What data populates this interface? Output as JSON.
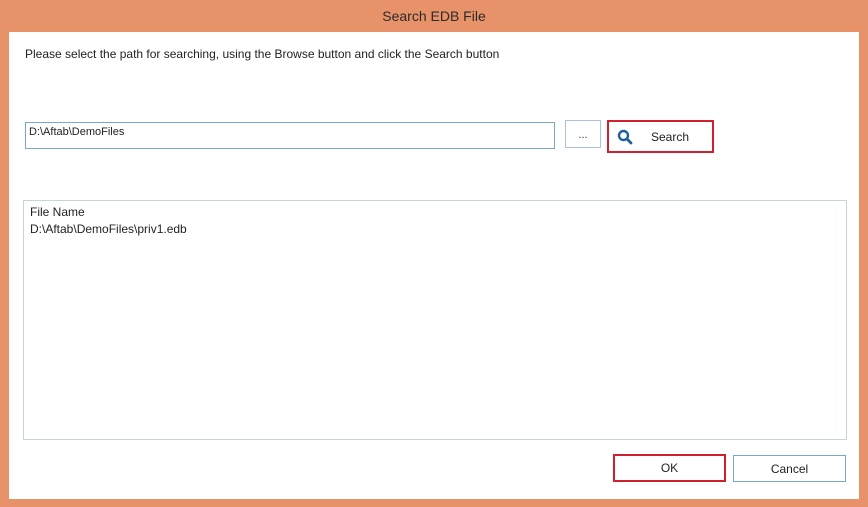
{
  "window": {
    "title": "Search EDB File",
    "frame_color": "#E8926A"
  },
  "instruction": "Please select the path for searching, using the Browse button and click the Search button",
  "path_input": {
    "value": "D:\\Aftab\\DemoFiles"
  },
  "browse_button": {
    "label": "..."
  },
  "search_button": {
    "label": "Search",
    "icon": "magnifier-icon"
  },
  "results": {
    "column_header": "File Name",
    "rows": [
      "D:\\Aftab\\DemoFiles\\priv1.edb"
    ]
  },
  "buttons": {
    "ok_label": "OK",
    "cancel_label": "Cancel"
  },
  "colors": {
    "highlight": "#d0202e",
    "input_border": "#7aa7cf"
  }
}
